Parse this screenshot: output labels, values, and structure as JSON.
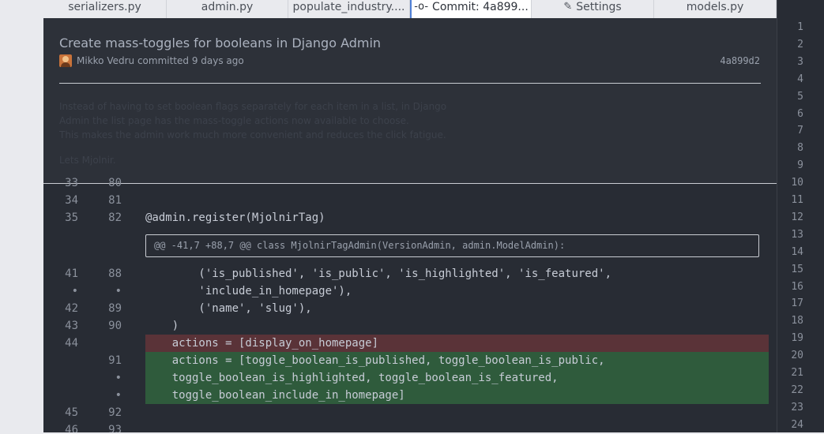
{
  "tabs": [
    {
      "label": "serializers.py",
      "icon": ""
    },
    {
      "label": "admin.py",
      "icon": ""
    },
    {
      "label": "populate_industry....",
      "icon": ""
    },
    {
      "label": "Commit: 4a899...",
      "icon": "commit-icon"
    },
    {
      "label": "Settings",
      "icon": "settings-icon"
    },
    {
      "label": "models.py",
      "icon": ""
    }
  ],
  "commit": {
    "title": "Create mass-toggles for booleans in Django Admin",
    "meta": "Mikko Vedru committed 9 days ago",
    "hash": "4a899d2",
    "description": [
      "Instead of having to set boolean flags separately for each item in a list, in Django",
      "Admin the list page has the mass-toggle actions now available to choose.",
      "This makes the admin work much more convenient and reduces the click fatigue.",
      "",
      "Lets Mjolnir."
    ]
  },
  "diff": {
    "hunk_header": "@@ -41,7 +88,7 @@ class MjolnirTagAdmin(VersionAdmin, admin.ModelAdmin):",
    "lines": [
      {
        "old": "33",
        "new": "80",
        "code": "",
        "type": "ctx"
      },
      {
        "old": "34",
        "new": "81",
        "code": "",
        "type": "ctx"
      },
      {
        "old": "35",
        "new": "82",
        "code": "@admin.register(MjolnirTag)",
        "type": "ctx"
      },
      {
        "old": "41",
        "new": "88",
        "code": "        ('is_published', 'is_public', 'is_highlighted', 'is_featured',",
        "type": "ctx"
      },
      {
        "old": "•",
        "new": "•",
        "code": "        'include_in_homepage'),",
        "type": "ctx"
      },
      {
        "old": "42",
        "new": "89",
        "code": "        ('name', 'slug'),",
        "type": "ctx"
      },
      {
        "old": "43",
        "new": "90",
        "code": "    )",
        "type": "ctx"
      },
      {
        "old": "44",
        "new": "",
        "code": "    actions = [display_on_homepage]",
        "type": "del"
      },
      {
        "old": "",
        "new": "91",
        "code": "    actions = [toggle_boolean_is_published, toggle_boolean_is_public,",
        "type": "add"
      },
      {
        "old": "",
        "new": "•",
        "code": "    toggle_boolean_is_highlighted, toggle_boolean_is_featured,",
        "type": "add"
      },
      {
        "old": "",
        "new": "•",
        "code": "    toggle_boolean_include_in_homepage]",
        "type": "add"
      },
      {
        "old": "45",
        "new": "92",
        "code": "",
        "type": "ctx"
      },
      {
        "old": "46",
        "new": "93",
        "code": "",
        "type": "ctx"
      }
    ]
  },
  "right_line_numbers": [
    "1",
    "2",
    "3",
    "4",
    "5",
    "6",
    "7",
    "8",
    "9",
    "10",
    "11",
    "12",
    "13",
    "14",
    "15",
    "16",
    "17",
    "18",
    "19",
    "20",
    "21",
    "22",
    "23",
    "24"
  ]
}
